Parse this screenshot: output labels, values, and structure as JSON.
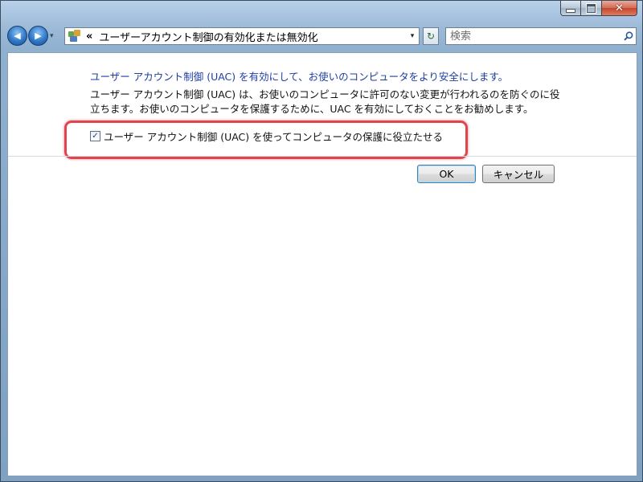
{
  "titlebar": {
    "minimize_glyph": "",
    "close_glyph": "✕"
  },
  "nav": {
    "back_glyph": "◀",
    "forward_glyph": "▶",
    "dropdown_glyph": "▾"
  },
  "address": {
    "chevron": "«",
    "path": "ユーザーアカウント制御の有効化または無効化",
    "dropdown_glyph": "▾"
  },
  "refresh_glyph": "↻",
  "search": {
    "placeholder": "検索"
  },
  "content": {
    "heading": "ユーザー アカウント制御 (UAC) を有効にして、お使いのコンピュータをより安全にします。",
    "description": "ユーザー アカウント制御 (UAC) は、お使いのコンピュータに許可のない変更が行われるのを防ぐのに役立ちます。お使いのコンピュータを保護するために、UAC を有効にしておくことをお勧めします。",
    "checkbox_label": "ユーザー アカウント制御 (UAC) を使ってコンピュータの保護に役立たせる",
    "checkbox_checked": true,
    "check_glyph": "✓"
  },
  "buttons": {
    "ok": "OK",
    "cancel": "キャンセル"
  },
  "colors": {
    "heading": "#1e3ea0",
    "highlight": "#e0454f"
  }
}
